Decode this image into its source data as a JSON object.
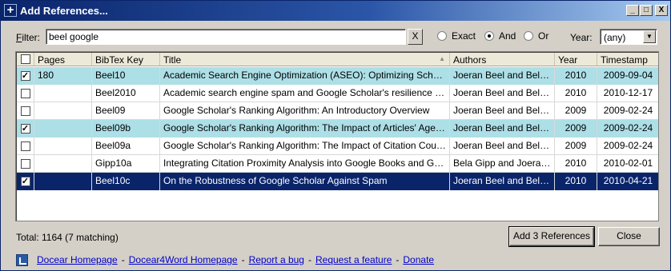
{
  "window": {
    "title": "Add References...",
    "app_icon": "plus-icon",
    "minimize_glyph": "_",
    "maximize_glyph": "□",
    "close_glyph": "X"
  },
  "filter": {
    "label_prefix": "F",
    "label_rest": "ilter:",
    "value": "beel google",
    "clear_label": "X",
    "match_modes": [
      {
        "label": "Exact",
        "selected": false
      },
      {
        "label": "And",
        "selected": true
      },
      {
        "label": "Or",
        "selected": false
      }
    ],
    "year_label": "Year:",
    "year_value": "(any)"
  },
  "table": {
    "columns": [
      "Pages",
      "BibTex Key",
      "Title",
      "Authors",
      "Year",
      "Timestamp"
    ],
    "rows": [
      {
        "checked": true,
        "pages": "180",
        "key": "Beel10",
        "title": "Academic Search Engine Optimization (ASEO): Optimizing Scholarly Liter...",
        "authors": "Joeran Beel and Bela Gi...",
        "year": "2010",
        "timestamp": "2009-09-04"
      },
      {
        "checked": false,
        "pages": "",
        "key": "Beel2010",
        "title": "Academic search engine spam and Google Scholar's resilience against it",
        "authors": "Joeran Beel and Bela Gi...",
        "year": "2010",
        "timestamp": "2010-12-17"
      },
      {
        "checked": false,
        "pages": "",
        "key": "Beel09",
        "title": "Google Scholar's Ranking Algorithm: An Introductory Overview",
        "authors": "Joeran Beel and Bela Gi...",
        "year": "2009",
        "timestamp": "2009-02-24"
      },
      {
        "checked": true,
        "pages": "",
        "key": "Beel09b",
        "title": "Google Scholar's Ranking Algorithm: The Impact of Articles' Age (An Em...",
        "authors": "Joeran Beel and Bela Gi...",
        "year": "2009",
        "timestamp": "2009-02-24"
      },
      {
        "checked": false,
        "pages": "",
        "key": "Beel09a",
        "title": "Google Scholar's Ranking Algorithm: The Impact of Citation Counts (An ...",
        "authors": "Joeran Beel and Bela Gi...",
        "year": "2009",
        "timestamp": "2009-02-24"
      },
      {
        "checked": false,
        "pages": "",
        "key": "Gipp10a",
        "title": "Integrating Citation Proximity Analysis into Google Books and Google Sch...",
        "authors": "Bela Gipp and Joeran B...",
        "year": "2010",
        "timestamp": "2010-02-01"
      },
      {
        "checked": true,
        "selected": true,
        "pages": "",
        "key": "Beel10c",
        "title": "On the Robustness of Google Scholar Against Spam",
        "authors": "Joeran Beel and Bela Gi...",
        "year": "2010",
        "timestamp": "2010-04-21"
      }
    ]
  },
  "footer": {
    "total": "Total: 1164 (7 matching)",
    "add_button": "Add 3 References",
    "close_button": "Close"
  },
  "links": [
    "Docear Homepage",
    "Docear4Word Homepage",
    "Report a bug",
    "Request a feature",
    "Donate"
  ],
  "colors": {
    "title_bar": "#0a246a",
    "checked_row": "#addfe7",
    "selected_row": "#0a246a",
    "link": "#0000cc"
  }
}
